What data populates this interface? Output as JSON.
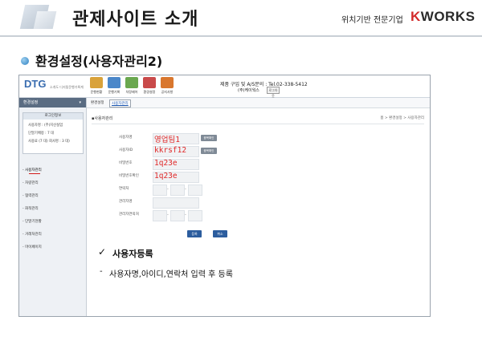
{
  "slide": {
    "title": "관제사이트 소개",
    "brand_tag": "위치기반 전문기업",
    "brand_logo_prefix": "K",
    "brand_logo_rest": "WORKS",
    "section_heading": "환경설정(사용자관리2)"
  },
  "app": {
    "logo": "DTG",
    "logo_sub": "소개도 디지털운행기록계",
    "toolbar": [
      {
        "label": "운행현황",
        "color": "#d9a23a"
      },
      {
        "label": "운행기록",
        "color": "#4a87c9"
      },
      {
        "label": "차량제어",
        "color": "#6aa84f"
      },
      {
        "label": "환경설정",
        "color": "#c94a4a"
      },
      {
        "label": "공지사항",
        "color": "#d9772e"
      }
    ],
    "contact": "제품 구입 및 A/S문의 : Tel.02-338-5412",
    "company": "(주)케이웍스",
    "logout": "로그아웃",
    "sidebar": {
      "header": "환경설정",
      "login_title": "로그인정보",
      "login_rows": [
        "사용자명 : (주)지산실업",
        "단말기배정 : 7 대",
        "사용료 (7 대) 회사명 : 3 대)"
      ],
      "menu": [
        "사용자관리",
        "차량관리",
        "협력관리",
        "화적관리",
        "단말기현황",
        "거래처관리",
        "마이페이지"
      ]
    },
    "tabs": [
      "환경설정",
      "사용자관리"
    ],
    "page_title": "사용자관리",
    "breadcrumb": "홈 > 환경설정 > 사용자관리",
    "form": {
      "rows": [
        {
          "label": "사용자명",
          "value": "영업팀1",
          "button": "중복확인"
        },
        {
          "label": "사용자ID",
          "value": "kkrsf12",
          "button": "중복확인"
        },
        {
          "label": "비밀번호",
          "value": "1q23e"
        },
        {
          "label": "비밀번호확인",
          "value": "1q23e"
        },
        {
          "label": "연락처"
        },
        {
          "label": "관리자명"
        },
        {
          "label": "관리자연락처"
        }
      ],
      "ok": "등록",
      "cancel": "취소"
    }
  },
  "note": {
    "check": "✓",
    "title": "사용자등록",
    "dash": "-",
    "desc": "사용자명,아이디,연락처 입력 후 등록"
  }
}
